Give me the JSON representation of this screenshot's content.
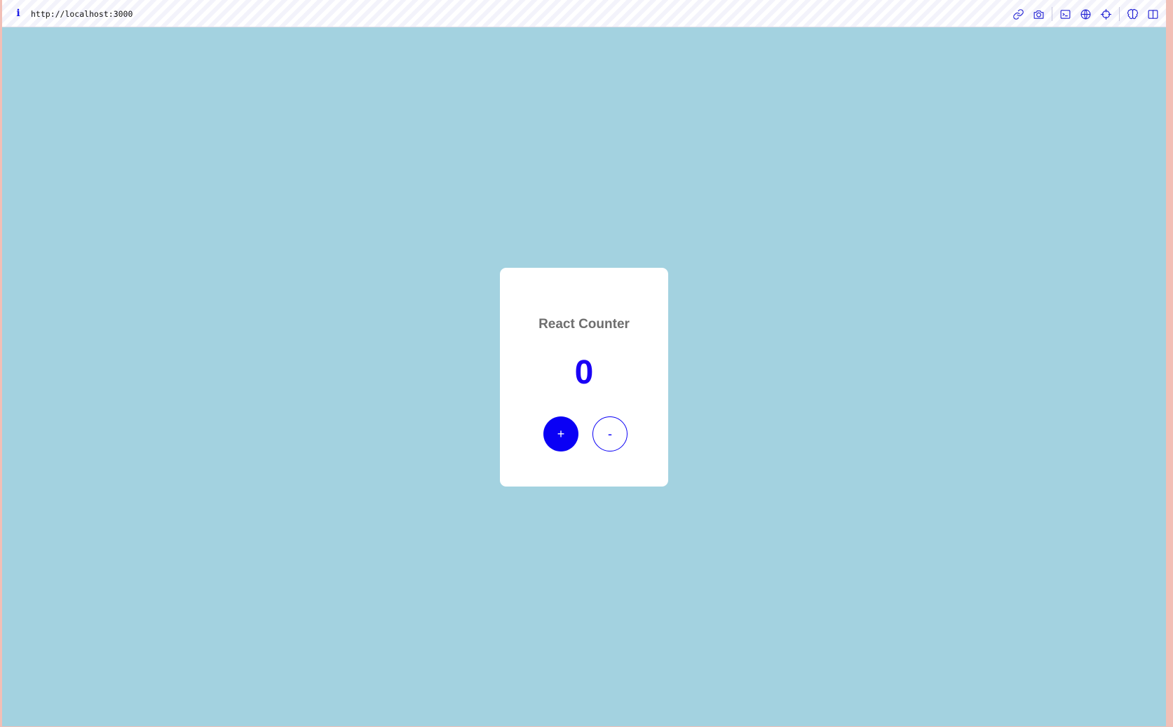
{
  "browser": {
    "url": "http://localhost:3000",
    "info_glyph": "i",
    "toolbar_icons": [
      "link-icon",
      "camera-icon",
      "terminal-icon",
      "globe-icon",
      "crosshair-icon",
      "brain-icon",
      "split-view-icon"
    ]
  },
  "counter": {
    "title": "React Counter",
    "value": "0",
    "increment_label": "+",
    "decrement_label": "-"
  },
  "colors": {
    "page_background": "#a3d2e0",
    "card_background": "#ffffff",
    "accent": "#0a00f5",
    "title_text": "#6e6e6e"
  }
}
